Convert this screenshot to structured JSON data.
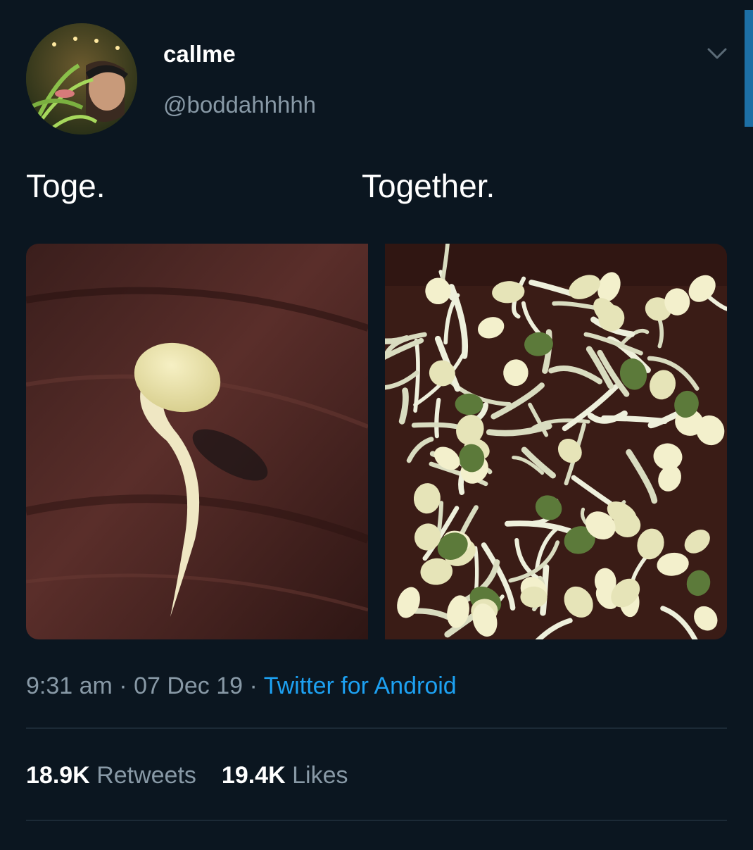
{
  "author": {
    "display_name": "callme",
    "handle": "@boddahhhhh"
  },
  "tweet": {
    "text_left": "Toge.",
    "text_right": "Together.",
    "media": [
      {
        "name": "single-bean-sprite-photo"
      },
      {
        "name": "many-bean-sprouts-photo"
      }
    ]
  },
  "meta": {
    "time": "9:31 am",
    "sep1": " · ",
    "date": "07 Dec 19",
    "sep2": " · ",
    "source": "Twitter for Android"
  },
  "stats": {
    "retweets_count": "18.9K",
    "retweets_label": "Retweets",
    "likes_count": "19.4K",
    "likes_label": "Likes"
  },
  "colors": {
    "background": "#0b1620",
    "link": "#1da1f2",
    "secondary_text": "#8899a6"
  }
}
